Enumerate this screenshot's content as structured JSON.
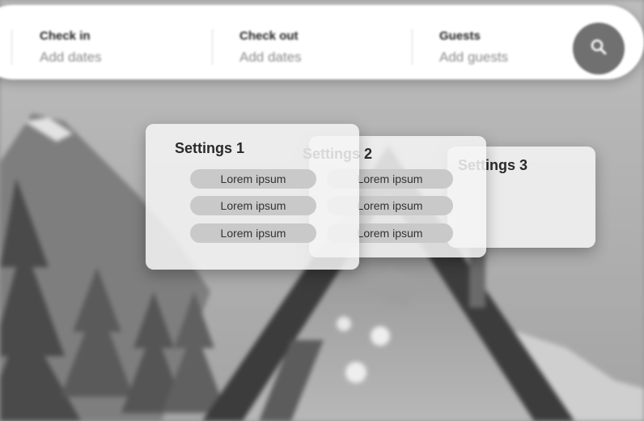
{
  "search": {
    "check_in": {
      "label": "Check in",
      "placeholder": "Add dates"
    },
    "check_out": {
      "label": "Check out",
      "placeholder": "Add dates"
    },
    "guests": {
      "label": "Guests",
      "placeholder": "Add guests"
    }
  },
  "cards": [
    {
      "title": "Settings 1",
      "items": [
        "Lorem ipsum",
        "Lorem ipsum",
        "Lorem ipsum"
      ]
    },
    {
      "title": "Settings 2",
      "items": [
        "Lorem ipsum",
        "Lorem ipsum",
        "Lorem ipsum"
      ]
    },
    {
      "title": "Settings 3",
      "items": []
    }
  ],
  "icons": {
    "search_button": "search-icon"
  },
  "colors": {
    "search_button_bg": "#707070",
    "pill_bg": "#c9c9c9"
  }
}
